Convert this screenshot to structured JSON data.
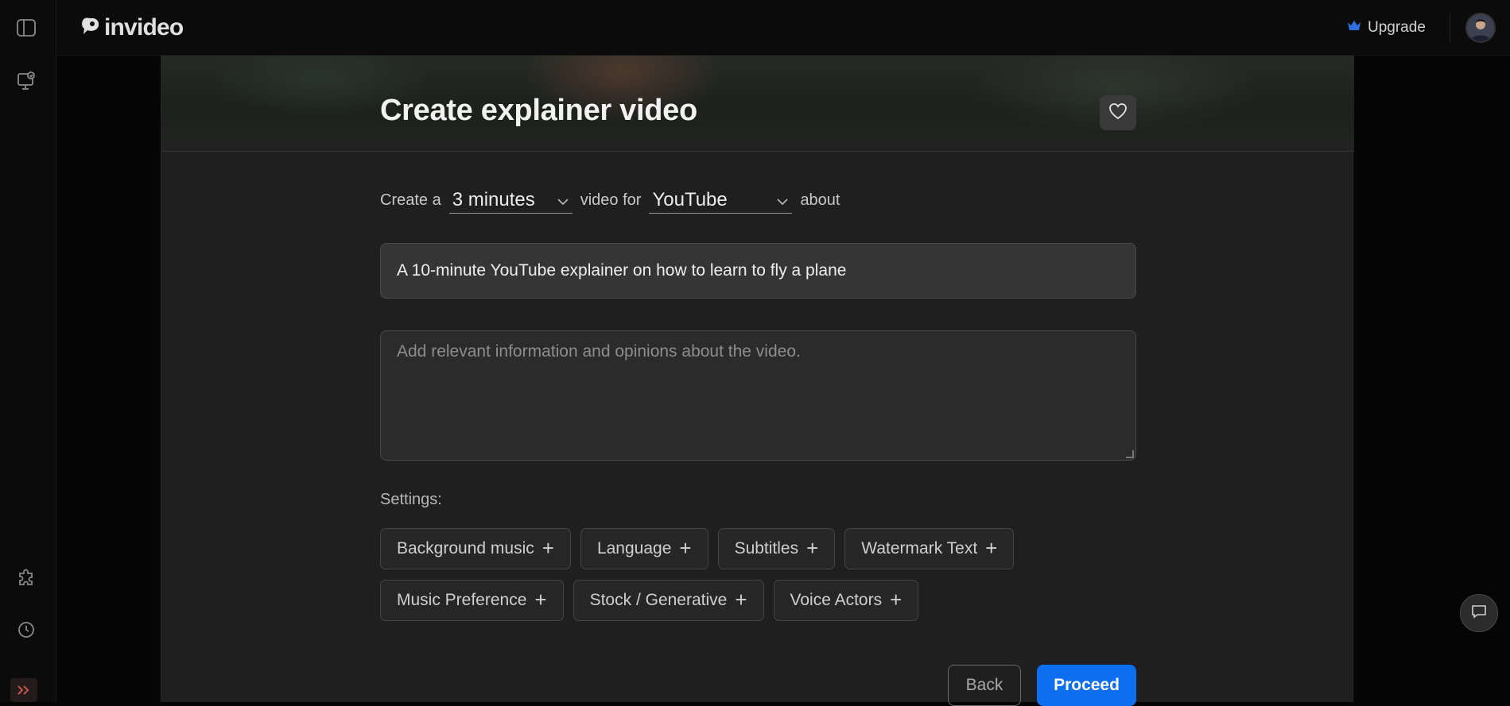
{
  "brand": {
    "name": "invideo",
    "accent_color": "#0d6ef0"
  },
  "header": {
    "upgrade_label": "Upgrade"
  },
  "sidebar": {
    "icons": [
      "sidebar-toggle-icon",
      "projects-icon",
      "plugins-icon",
      "history-icon",
      "expand-icon"
    ]
  },
  "form": {
    "title": "Create explainer video",
    "sentence": {
      "prefix": "Create a",
      "duration_value": "3 minutes",
      "middle": "video for",
      "platform_value": "YouTube",
      "suffix": "about"
    },
    "topic_value": "A 10-minute YouTube explainer on how to learn to fly a plane",
    "notes_placeholder": "Add relevant information and opinions about the video.",
    "settings_label": "Settings:",
    "settings_row1": [
      "Background music",
      "Language",
      "Subtitles",
      "Watermark Text"
    ],
    "settings_row2": [
      "Music Preference",
      "Stock / Generative",
      "Voice Actors"
    ],
    "back_label": "Back",
    "proceed_label": "Proceed"
  }
}
